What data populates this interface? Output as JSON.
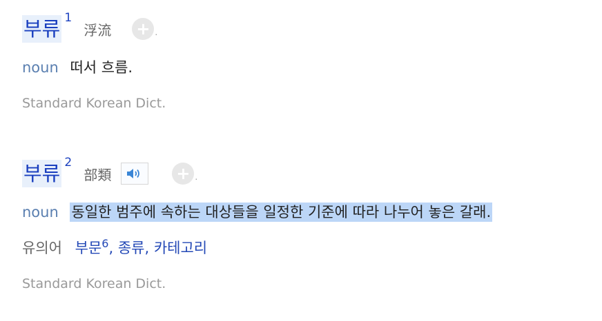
{
  "entries": [
    {
      "word": "부류",
      "superscript": "1",
      "hanja": "浮流",
      "add_button_label": "+",
      "add_dot": ".",
      "pos": "noun",
      "definition": "떠서 흐름.",
      "source": "Standard Korean Dict."
    },
    {
      "word": "부류",
      "superscript": "2",
      "hanja": "部類",
      "speaker_icon": "speaker-icon",
      "add_button_label": "+",
      "add_dot": ".",
      "pos": "noun",
      "definition": "동일한 범주에 속하는 대상들을 일정한 기준에 따라 나누어 놓은 갈래.",
      "synonyms_label": "유의어",
      "synonyms": [
        {
          "text": "부문",
          "superscript": "6"
        },
        {
          "text": "종류"
        },
        {
          "text": "카테고리"
        }
      ],
      "source": "Standard Korean Dict."
    }
  ],
  "colors": {
    "word": "#1a3fbf",
    "pos": "#5a7fb0",
    "highlight": "#bcd6f7",
    "source": "#999999"
  }
}
